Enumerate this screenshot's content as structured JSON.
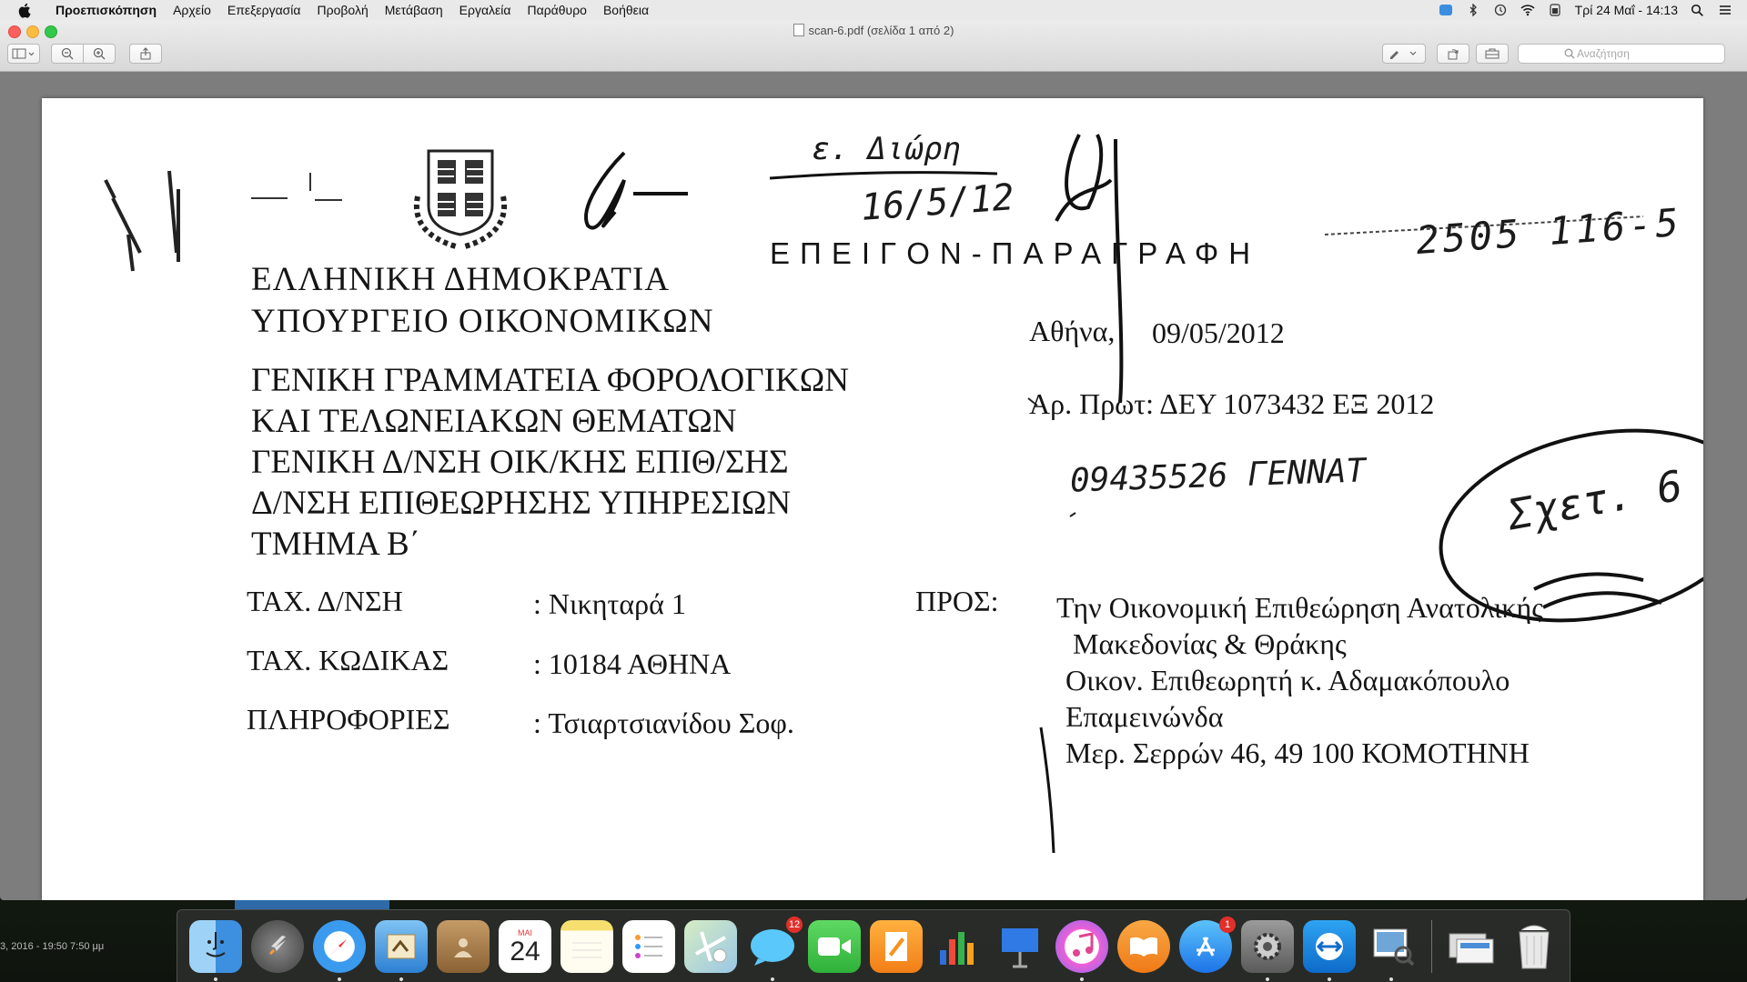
{
  "menubar": {
    "app_name": "Προεπισκόπηση",
    "items": [
      "Αρχείο",
      "Επεξεργασία",
      "Προβολή",
      "Μετάβαση",
      "Εργαλεία",
      "Παράθυρο",
      "Βοήθεια"
    ],
    "clock": "Τρί 24 Μαΐ - 14:13"
  },
  "window": {
    "title": "scan-6.pdf (σελίδα 1 από 2)",
    "search_placeholder": "Αναζήτηση"
  },
  "document": {
    "handwritten_top_1": "ε. Διώρη",
    "handwritten_top_2": "16/5/12",
    "handwritten_number": "2505 116-5",
    "stamp": "ΕΠΕΙΓΟΝ-ΠΑΡΑΓΡΑΦΗ",
    "header_line_1": "ΕΛΛΗΝΙΚΗ ΔΗΜΟΚΡΑΤΙΑ",
    "header_line_2": "ΥΠΟΥΡΓΕΙΟ ΟΙΚΟΝΟΜΙΚΩΝ",
    "date_label": "Αθήνα,",
    "date_value": "09/05/2012",
    "dept_line_1": "ΓΕΝΙΚΗ ΓΡΑΜΜΑΤΕΙΑ ΦΟΡΟΛΟΓΙΚΩΝ",
    "dept_line_2": "ΚΑΙ ΤΕΛΩΝΕΙΑΚΩΝ ΘΕΜΑΤΩΝ",
    "dept_line_3": "ΓΕΝΙΚΗ Δ/ΝΣΗ ΟΙΚ/ΚΗΣ ΕΠΙΘ/ΣΗΣ",
    "dept_line_4": "Δ/ΝΣΗ ΕΠΙΘΕΩΡΗΣΗΣ ΥΠΗΡΕΣΙΩΝ",
    "dept_line_5": "ΤΜΗΜΑ Β΄",
    "protocol": "Αρ. Πρωτ: ΔΕΥ 1073432 ΕΞ 2012",
    "handwritten_code": "09435526 ΓΕΝΝΑΤ",
    "handwritten_circle": "Σχετ. 6",
    "fields": [
      {
        "label": "ΤΑΧ. Δ/ΝΣΗ",
        "value": ": Νικηταρά 1"
      },
      {
        "label": "ΤΑΧ. ΚΩΔΙΚΑΣ",
        "value": ": 10184 ΑΘΗΝΑ"
      },
      {
        "label": "ΠΛΗΡΟΦΟΡΙΕΣ",
        "value": ": Τσιαρτσιανίδου  Σοφ."
      }
    ],
    "to_label": "ΠΡΟΣ:",
    "recipient": [
      "Την Οικονομική Επιθεώρηση  Ανατολικής",
      "Μακεδονίας & Θράκης",
      "Οικον. Επιθεωρητή κ. Αδαμακόπουλο",
      "Επαμεινώνδα",
      "Μερ. Σερρών 46,  49 100 ΚΟΜΟΤΗΝΗ"
    ]
  },
  "dock": {
    "apps": [
      "Finder",
      "Launchpad",
      "Safari",
      "Mail",
      "Contacts",
      "Calendar",
      "Notes",
      "Reminders",
      "Maps",
      "Messages",
      "FaceTime",
      "Pages",
      "Numbers",
      "Keynote",
      "iTunes",
      "iBooks",
      "App Store",
      "System Preferences",
      "TeamViewer",
      "Preview"
    ],
    "calendar_month": "ΜΑΙ",
    "calendar_day": "24",
    "messages_badge": "12",
    "appstore_badge": "1"
  },
  "background": {
    "timestamp": "3, 2016 - 19:50 7:50 μμ"
  }
}
